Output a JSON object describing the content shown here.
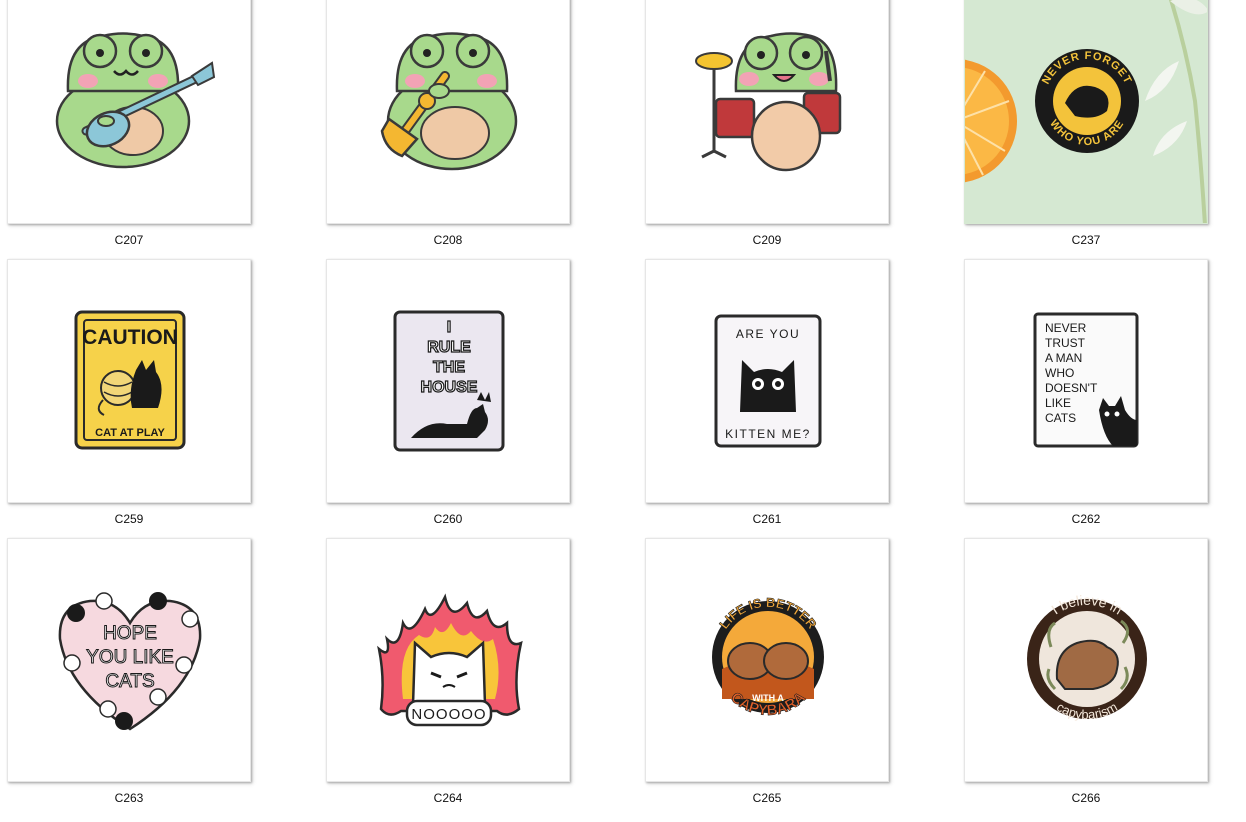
{
  "items": [
    {
      "code": "C207"
    },
    {
      "code": "C208"
    },
    {
      "code": "C209"
    },
    {
      "code": "C237",
      "pin_text": {
        "top": "NEVER FORGET",
        "bottom": "WHO YOU ARE"
      }
    },
    {
      "code": "C259",
      "pin_text": {
        "top": "CAUTION",
        "bottom": "CAT AT PLAY"
      }
    },
    {
      "code": "C260",
      "pin_text": {
        "l1": "I",
        "l2": "RULE",
        "l3": "THE",
        "l4": "HOUSE"
      }
    },
    {
      "code": "C261",
      "pin_text": {
        "top": "ARE YOU",
        "bottom": "KITTEN ME?"
      }
    },
    {
      "code": "C262",
      "pin_text": {
        "l1": "NEVER",
        "l2": "TRUST",
        "l3": "A MAN",
        "l4": "WHO",
        "l5": "DOESN'T",
        "l6": "LIKE",
        "l7": "CATS"
      }
    },
    {
      "code": "C263",
      "pin_text": {
        "l1": "HOPE",
        "l2": "YOU LIKE",
        "l3": "CATS"
      }
    },
    {
      "code": "C264",
      "pin_text": {
        "bottom": "NOOOOO"
      }
    },
    {
      "code": "C265",
      "pin_text": {
        "top": "LIFE IS BETTER",
        "mid": "WITH A",
        "bottom": "CAPYBARA"
      }
    },
    {
      "code": "C266",
      "pin_text": {
        "top": "I believe in",
        "bottom": "capybarism"
      }
    }
  ]
}
